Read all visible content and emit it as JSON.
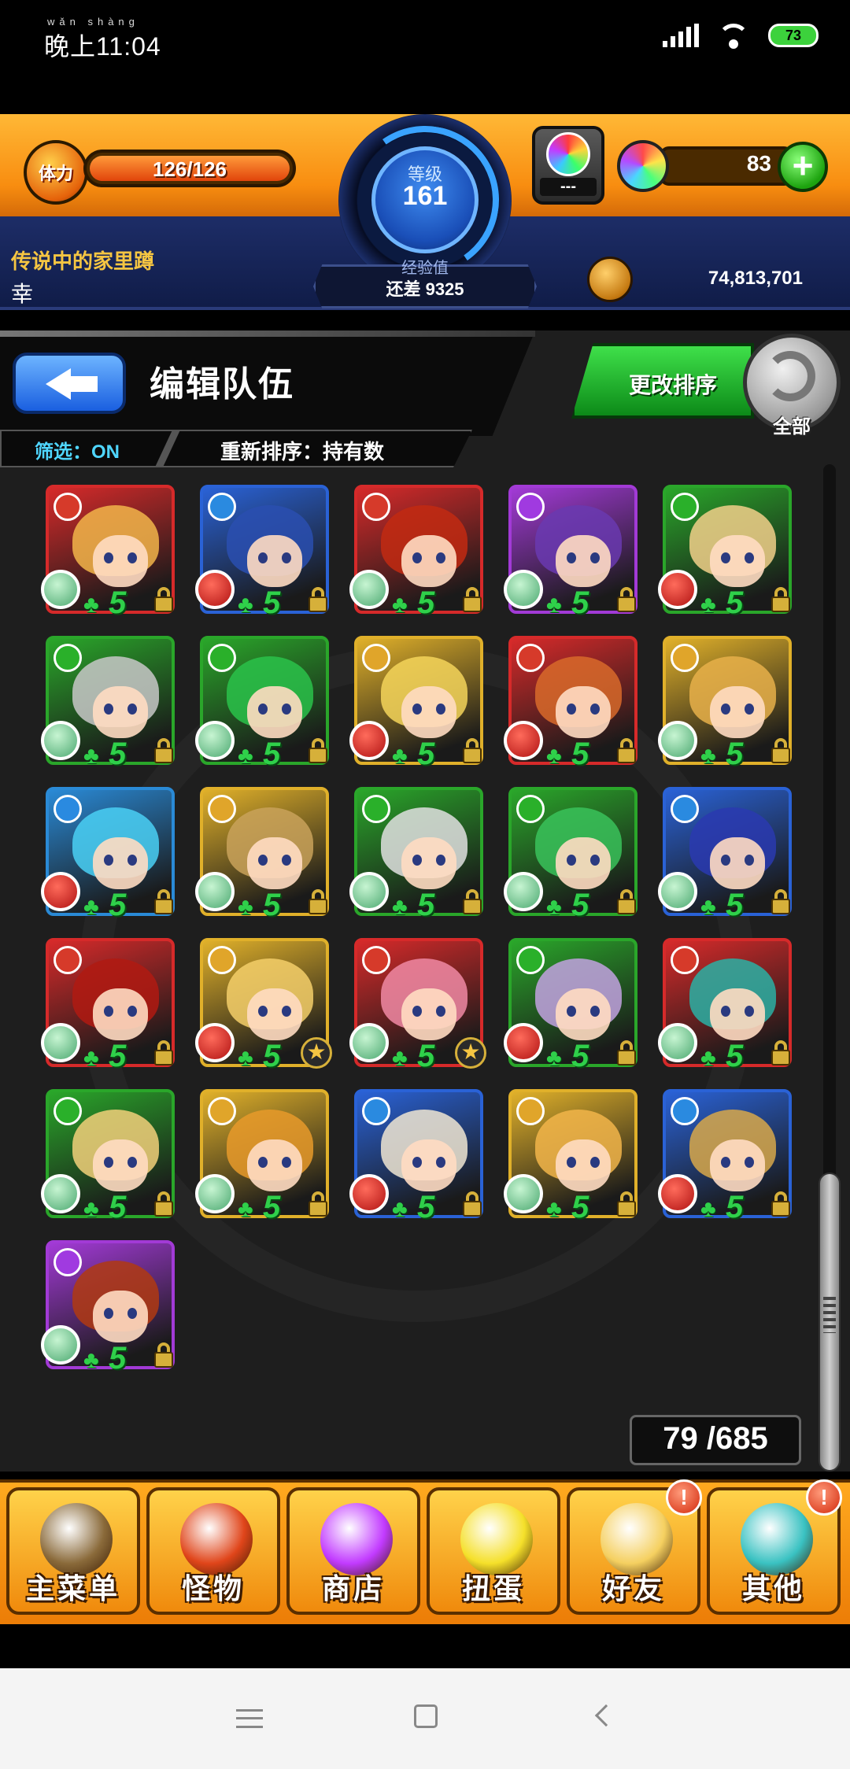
{
  "status_bar": {
    "time": "晚上11:04",
    "time_pinyin": "wǎn shàng",
    "battery": "73"
  },
  "header": {
    "stamina_icon_label": "体力",
    "stamina": "126/126",
    "level_label": "等级",
    "level": "161",
    "exp_label": "经验值",
    "exp_remaining": "还差 9325",
    "gacha_text": "---",
    "orb_count": "83",
    "player_name": "传说中的家里蹲",
    "player_sub": "幸",
    "coins": "74,813,701"
  },
  "panel": {
    "title": "编辑队伍",
    "sort_button": "更改排序",
    "all_button": "全部",
    "filter": "筛选：ON",
    "resort": "重新排序：持有数",
    "count": "79 /685"
  },
  "cards": [
    {
      "border": "#d62a2a",
      "hair": "#f2b54a",
      "elem": "#d63a2a",
      "badge": "grn",
      "star": false
    },
    {
      "border": "#2a62d6",
      "hair": "#2a4fb0",
      "elem": "#2a8ae0",
      "badge": "red",
      "star": false
    },
    {
      "border": "#d62a2a",
      "hair": "#c22a12",
      "elem": "#d63a2a",
      "badge": "grn",
      "star": false
    },
    {
      "border": "#a23ad6",
      "hair": "#6a3ab0",
      "elem": "#a03ae0",
      "badge": "grn",
      "star": false
    },
    {
      "border": "#2aa62a",
      "hair": "#f2d08a",
      "elem": "#2ab02a",
      "badge": "red",
      "star": false
    },
    {
      "border": "#2aa62a",
      "hair": "#c8c8c8",
      "elem": "#2ab02a",
      "badge": "grn",
      "star": false
    },
    {
      "border": "#2aa62a",
      "hair": "#2ac24a",
      "elem": "#2ab02a",
      "badge": "grn",
      "star": false
    },
    {
      "border": "#e0b02a",
      "hair": "#f5d55a",
      "elem": "#e0a52a",
      "badge": "red",
      "star": false
    },
    {
      "border": "#d62a2a",
      "hair": "#d86a2a",
      "elem": "#d63a2a",
      "badge": "red",
      "star": false
    },
    {
      "border": "#e0b02a",
      "hair": "#e8b04a",
      "elem": "#e0a52a",
      "badge": "grn",
      "star": false
    },
    {
      "border": "#2a8ad6",
      "hair": "#4ad0f5",
      "elem": "#2a8ae0",
      "badge": "red",
      "star": false
    },
    {
      "border": "#e0b02a",
      "hair": "#c9a25a",
      "elem": "#e0a52a",
      "badge": "grn",
      "star": false
    },
    {
      "border": "#2aa62a",
      "hair": "#e0e0e0",
      "elem": "#2ab02a",
      "badge": "grn",
      "star": false
    },
    {
      "border": "#2aa62a",
      "hair": "#3ac25a",
      "elem": "#2ab02a",
      "badge": "grn",
      "star": false
    },
    {
      "border": "#2a62d6",
      "hair": "#2a3ab0",
      "elem": "#2a8ae0",
      "badge": "grn",
      "star": false
    },
    {
      "border": "#d62a2a",
      "hair": "#b01a12",
      "elem": "#d63a2a",
      "badge": "grn",
      "star": false
    },
    {
      "border": "#e0b02a",
      "hair": "#f5cf6a",
      "elem": "#e0a52a",
      "badge": "red",
      "star": true
    },
    {
      "border": "#d62a2a",
      "hair": "#f08aa5",
      "elem": "#d63a2a",
      "badge": "grn",
      "star": true
    },
    {
      "border": "#2aa62a",
      "hair": "#c2a2e0",
      "elem": "#2ab02a",
      "badge": "red",
      "star": false
    },
    {
      "border": "#d62a2a",
      "hair": "#2ab0a5",
      "elem": "#d63a2a",
      "badge": "grn",
      "star": false
    },
    {
      "border": "#2aa62a",
      "hair": "#f2d07a",
      "elem": "#2ab02a",
      "badge": "grn",
      "star": false
    },
    {
      "border": "#e0b02a",
      "hair": "#e89a2a",
      "elem": "#e0a52a",
      "badge": "grn",
      "star": false
    },
    {
      "border": "#2a62d6",
      "hair": "#f0e6d2",
      "elem": "#2a8ae0",
      "badge": "red",
      "star": false
    },
    {
      "border": "#e0b02a",
      "hair": "#f2b54a",
      "elem": "#e0a52a",
      "badge": "grn",
      "star": false
    },
    {
      "border": "#2a62d6",
      "hair": "#d8a84a",
      "elem": "#2a8ae0",
      "badge": "red",
      "star": false
    },
    {
      "border": "#a23ad6",
      "hair": "#b03a12",
      "elem": "#a03ae0",
      "badge": "grn",
      "star": false
    }
  ],
  "card_level": "5",
  "menu": [
    {
      "label": "主菜单",
      "icon": "castle-gate-icon",
      "color": "#8a6a3a",
      "alert": false
    },
    {
      "label": "怪物",
      "icon": "monster-icon",
      "color": "#e0451a",
      "alert": false
    },
    {
      "label": "商店",
      "icon": "rainbow-orb-icon",
      "color": "#c23bff",
      "alert": false
    },
    {
      "label": "扭蛋",
      "icon": "egg-icon",
      "color": "#f5e02a",
      "alert": false
    },
    {
      "label": "好友",
      "icon": "friends-icon",
      "color": "#f5d060",
      "alert": true
    },
    {
      "label": "其他",
      "icon": "question-icon",
      "color": "#3ac2c2",
      "alert": true
    }
  ],
  "alert_glyph": "!",
  "star_glyph": "★",
  "clover_glyph": "♣"
}
